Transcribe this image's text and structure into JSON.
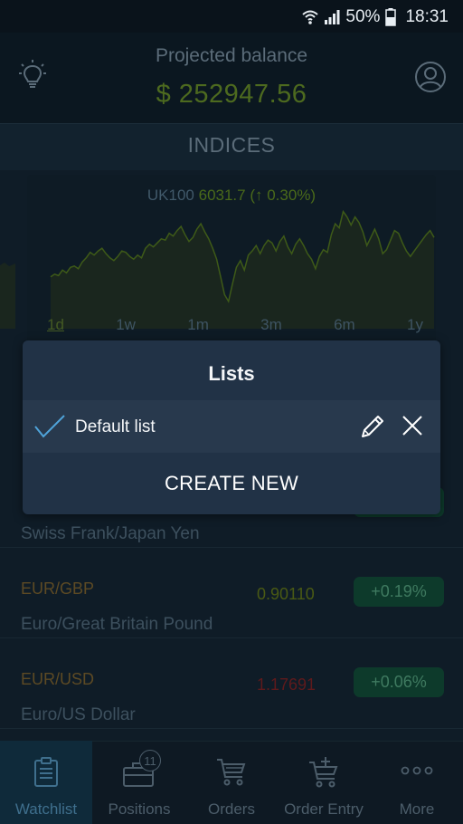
{
  "status_bar": {
    "battery": "50%",
    "time": "18:31"
  },
  "header": {
    "projected_label": "Projected balance",
    "projected_value": "$ 252947.56",
    "section_title": "INDICES"
  },
  "chart": {
    "symbol": "UK100",
    "value": "6031.7",
    "change": "(↑ 0.30%)",
    "ranges": [
      "1d",
      "1w",
      "1m",
      "3m",
      "6m",
      "1y"
    ],
    "active_range": "1d"
  },
  "chart_data": {
    "type": "area",
    "title": "",
    "series": [
      {
        "values": [
          6003,
          6005,
          6004,
          6008,
          6006,
          6010,
          6011,
          6009,
          6014,
          6017,
          6021,
          6019,
          6022,
          6024,
          6020,
          6017,
          6015,
          6018,
          6022,
          6021,
          6018,
          6016,
          6019,
          6017,
          6024,
          6027,
          6025,
          6028,
          6031,
          6030,
          6035,
          6033,
          6037,
          6040,
          6034,
          6029,
          6032,
          6038,
          6042,
          6036,
          6031,
          6024,
          6016,
          6003,
          5990,
          5985,
          5998,
          6010,
          6015,
          6008,
          6019,
          6022,
          6026,
          6020,
          6026,
          6030,
          6028,
          6022,
          6029,
          6033,
          6025,
          6020,
          6027,
          6031,
          6026,
          6020,
          6016,
          6009,
          6018,
          6023,
          6021,
          6034,
          6042,
          6039,
          6051,
          6047,
          6041,
          6047,
          6043,
          6036,
          6026,
          6032,
          6038,
          6031,
          6020,
          6023,
          6030,
          6037,
          6035,
          6028,
          6022,
          6018,
          6022,
          6026,
          6030,
          6034,
          6037,
          6032
        ]
      }
    ]
  },
  "modal": {
    "title": "Lists",
    "items": [
      {
        "label": "Default list"
      }
    ],
    "create_label": "CREATE NEW"
  },
  "rows": [
    {
      "symbol": "",
      "desc": "Swiss Frank/Japan Yen",
      "price": "",
      "change": ""
    },
    {
      "symbol": "EUR/GBP",
      "desc": "Euro/Great Britain Pound",
      "price": "0.90110",
      "change": "+0.19%"
    },
    {
      "symbol": "EUR/USD",
      "desc": "Euro/US Dollar",
      "price": "1.17691",
      "change": "+0.06%"
    }
  ],
  "colors": {
    "price_up": "#4a5a14",
    "price_down": "#5e1a1c",
    "accent": "#3f6f8d"
  },
  "nav": {
    "items": [
      {
        "label": "Watchlist"
      },
      {
        "label": "Positions",
        "badge": "11"
      },
      {
        "label": "Orders"
      },
      {
        "label": "Order Entry"
      },
      {
        "label": "More"
      }
    ]
  }
}
